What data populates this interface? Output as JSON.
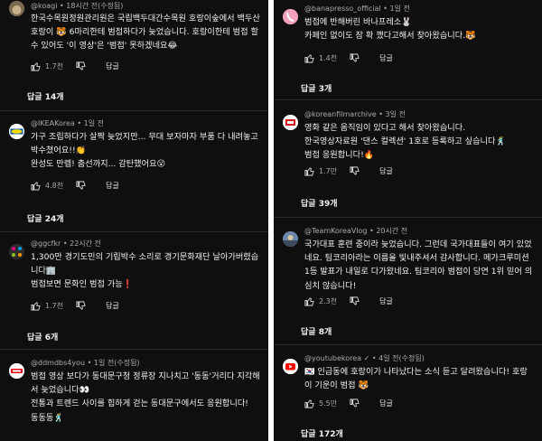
{
  "left": [
    {
      "handle": "@koagi",
      "time": "18시간 전(수정됨)",
      "text": "한국수목원정원관리원은 국립백두대간수목원 호랑이숲에서 백두산호랑이 🐯 6마리한테 범접하다가 늦었습니다. 호랑이한테 범접 할 수 있어도 '이 영상'은 '범접' 못하겠네요😂",
      "likes": "1.7천",
      "reply_label": "답글",
      "replies_label": "답글 14개"
    },
    {
      "handle": "@IKEAKorea",
      "time": "1일 전",
      "text": "가구 조립하다가 살짝 늦었지만... 무대 보자마자 부품 다 내려놓고 박수쳤어요!!👏\n완성도 만렙! 춤선까지... 감탄했어요😮",
      "likes": "4.8천",
      "reply_label": "답글",
      "replies_label": "답글 24개"
    },
    {
      "handle": "@ggcfkr",
      "time": "22시간 전",
      "text": "1,300만 경기도민의 기립박수 소리로 경기문화재단 날아가버렸습니다🏢\n범접보면 문화인 범접 가능❗",
      "likes": "1.7천",
      "reply_label": "답글",
      "replies_label": "답글 6개"
    },
    {
      "handle": "@ddmdbs4you",
      "time": "1일 전(수정됨)",
      "text": "범접 영상 보다가 동대문구청 정류장 지나치고 '동동'거리다 지각해서 늦었습니다👀\n전통과 트렌드 사이를 힙하게 걷는 동대문구에서도 응원합니다!\n동동동🕺",
      "likes": "",
      "reply_label": "",
      "replies_label": ""
    }
  ],
  "right": [
    {
      "handle": "@banapresso_official",
      "time": "1일 전",
      "text": "범접에 반해버린 바나프레소🐰\n카페인 없이도 잠 확 깼다고해서 찾아왔습니다.🐯",
      "likes": "1.4천",
      "reply_label": "답글",
      "replies_label": "답글 3개"
    },
    {
      "handle": "@koreanfilmarchive",
      "time": "3일 전",
      "text": "영화 같은 움직임이 있다고 해서 찾아왔습니다.\n한국영상자료원 '댄스 컬렉션' 1호로 등록하고 싶습니다🕺\n범접 응원합니다!🔥",
      "likes": "1.7만",
      "reply_label": "답글",
      "replies_label": "답글 39개"
    },
    {
      "handle": "@TeamKoreaVlog",
      "time": "20시간 전",
      "text": "국가대표 훈련 중이라 늦었습니다. 그런데 국가대표들이 여기 있었네요. 팀코리아라는 이름을 빛내주셔서 감사합니다. 메가크루미션 1등 발표가 내일로 다가왔네요. 팀코리아 범접이 당연 1위 믿어 의심치 않습니다!",
      "likes": "2.3천",
      "reply_label": "답글",
      "replies_label": "답글 8개"
    },
    {
      "handle": "@youtubekorea",
      "verified": "✓",
      "time": "4일 전(수정됨)",
      "text": "🇰🇷 인급동에 호랑이가 나타났다는 소식 듣고 달려왔습니다! 호랑이 기운이 범접 🐯",
      "likes": "5.5만",
      "reply_label": "답글",
      "replies_label": "답글 172개"
    }
  ],
  "colors": {
    "background": "#0f0f0f",
    "text": "#f1f1f1",
    "meta": "#aaaaaa"
  }
}
